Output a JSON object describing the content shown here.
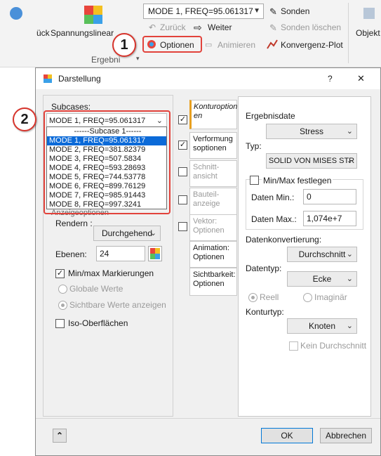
{
  "ribbon": {
    "zurueck_partial": "ück",
    "spannung_label": "Spannungslinear",
    "ergebnis_group": "Ergebni",
    "mode_combo": "MODE 1, FREQ=95.061317",
    "zurueck": "Zurück",
    "weiter": "Weiter",
    "optionen": "Optionen",
    "animieren": "Animieren",
    "sonden": "Sonden",
    "sonden_loeschen": "Sonden löschen",
    "konvergenz": "Konvergenz-Plot",
    "objekt_partial": "Objekt"
  },
  "callouts": {
    "c1": "1",
    "c2": "2"
  },
  "dialog": {
    "title": "Darstellung",
    "help": "?",
    "close": "✕",
    "subcases_label": "Subcases:",
    "subcase_selected": "MODE 1, FREQ=95.061317",
    "subcase_list": [
      "------Subcase 1------",
      "MODE 1, FREQ=95.061317",
      "MODE 2, FREQ=381.82379",
      "MODE 3, FREQ=507.5834",
      "MODE 4, FREQ=593.28693",
      "MODE 5, FREQ=744.53778",
      "MODE 6, FREQ=899.76129",
      "MODE 7, FREQ=985.91443",
      "MODE 8, FREQ=997.3241"
    ],
    "anzeige_partial": "Anzeigeoptionen",
    "rendern_label": "Rendern :",
    "rendern_value": "Durchgehend",
    "ebenen_label": "Ebenen:",
    "ebenen_value": "24",
    "minmax_markierungen": "Min/max Markierungen",
    "globale_werte": "Globale Werte",
    "sichtbare_werte": "Sichtbare Werte anzeigen",
    "iso": "Iso-Oberflächen",
    "tabs": [
      "Konturoption en",
      "Verformung soptionen",
      "Schnitt- ansicht",
      "Bauteil- anzeige",
      "Vektor: Optionen",
      "Animation: Optionen",
      "Sichtbarkeit: Optionen"
    ],
    "ergebnisdaten_label": "Ergebnisdate",
    "ergebnis_value": "Stress",
    "typ_label": "Typ:",
    "typ_value": "SOLID VON MISES STR",
    "minmax_fest": "Min/Max festlegen",
    "daten_min_label": "Daten Min.:",
    "daten_min_value": "0",
    "daten_max_label": "Daten Max.:",
    "daten_max_value": "1,074e+7",
    "datenkonv_label": "Datenkonvertierung:",
    "datenkonv_value": "Durchschnitt",
    "datentyp_label": "Datentyp:",
    "datentyp_value": "Ecke",
    "reell": "Reell",
    "imaginaer": "Imaginär",
    "konturtyp_label": "Konturtyp:",
    "konturtyp_value": "Knoten",
    "kein_durchschnitt": "Kein Durchschnitt",
    "expand": "⌃",
    "ok": "OK",
    "abbrechen": "Abbrechen"
  }
}
